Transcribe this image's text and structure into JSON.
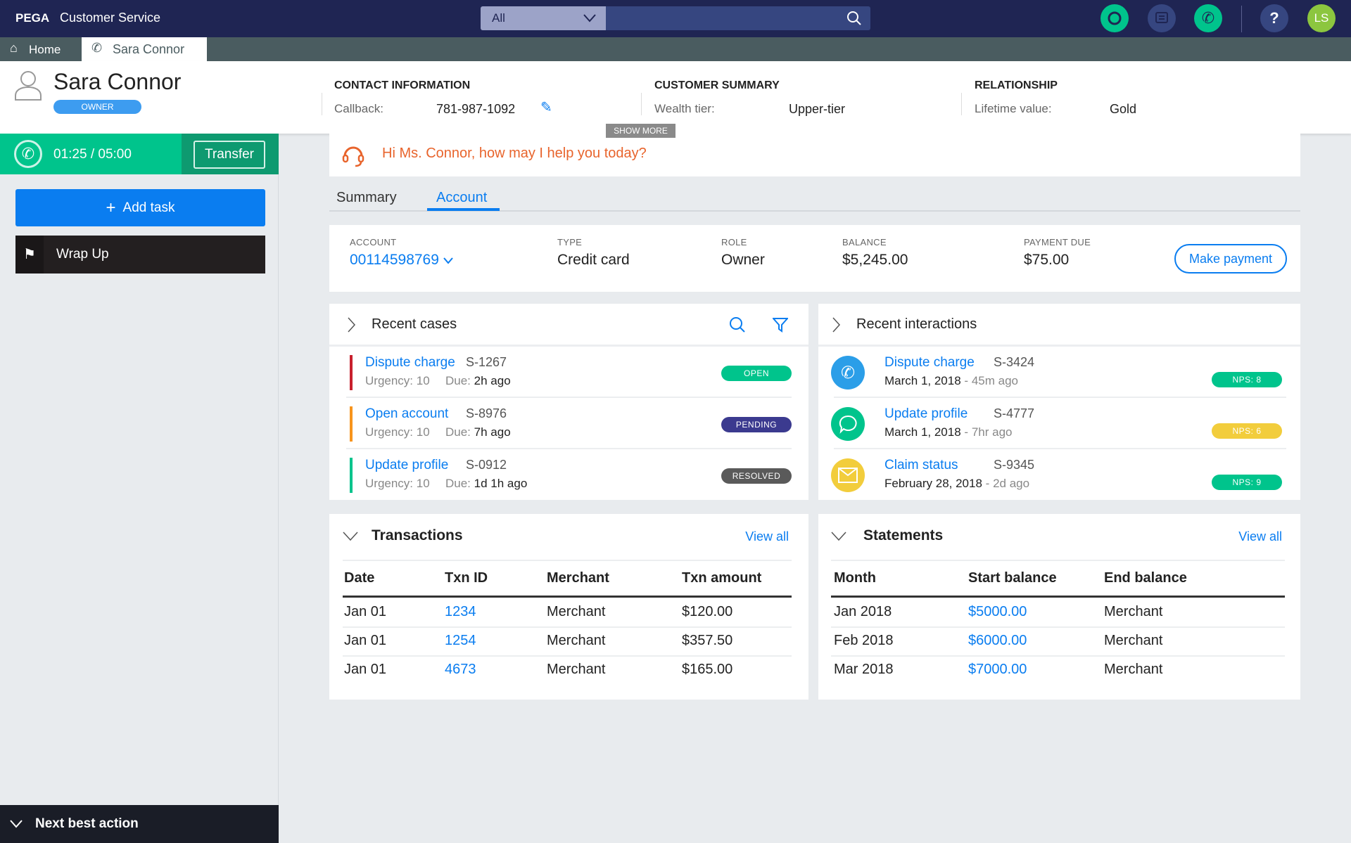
{
  "app": {
    "logo": "PEGA",
    "title": "Customer Service"
  },
  "search": {
    "scope": "All",
    "placeholder": ""
  },
  "topbar": {
    "user_initials": "LS",
    "help": "?"
  },
  "tabs": [
    {
      "label": "Home"
    },
    {
      "label": "Sara Connor"
    }
  ],
  "customer": {
    "name": "Sara Connor",
    "role": "OWNER"
  },
  "contact": {
    "title": "CONTACT INFORMATION",
    "label": "Callback:",
    "value": "781-987-1092"
  },
  "summary": {
    "title": "CUSTOMER SUMMARY",
    "label": "Wealth tier:",
    "value": "Upper-tier"
  },
  "relationship": {
    "title": "RELATIONSHIP",
    "label": "Lifetime value:",
    "value": "Gold"
  },
  "show_more": "SHOW MORE",
  "call": {
    "timer": "01:25 / 05:00",
    "transfer": "Transfer"
  },
  "sidebar": {
    "add_task": "Add task",
    "wrap_up": "Wrap Up",
    "next_best_action": "Next best action"
  },
  "greeting": "Hi Ms. Connor, how may I help you today?",
  "main_tabs": [
    {
      "label": "Summary"
    },
    {
      "label": "Account"
    }
  ],
  "account": {
    "account_label": "ACCOUNT",
    "account_value": "00114598769",
    "type_label": "TYPE",
    "type_value": "Credit card",
    "role_label": "ROLE",
    "role_value": "Owner",
    "balance_label": "BALANCE",
    "balance_value": "$5,245.00",
    "due_label": "PAYMENT DUE",
    "due_value": "$75.00",
    "make_payment": "Make payment"
  },
  "recent_cases": {
    "title": "Recent cases",
    "items": [
      {
        "title": "Dispute charge",
        "id": "S-1267",
        "urgency_label": "Urgency:",
        "urgency": "10",
        "due_label": "Due:",
        "due": "2h ago",
        "status": "OPEN",
        "color": "#c8202d",
        "status_color": "#00c48c"
      },
      {
        "title": "Open account",
        "id": "S-8976",
        "urgency_label": "Urgency:",
        "urgency": "10",
        "due_label": "Due:",
        "due": "7h ago",
        "status": "PENDING",
        "color": "#f7941d",
        "status_color": "#3b3a8f"
      },
      {
        "title": "Update profile",
        "id": "S-0912",
        "urgency_label": "Urgency:",
        "urgency": "10",
        "due_label": "Due:",
        "due": "1d 1h ago",
        "status": "RESOLVED",
        "color": "#00c48c",
        "status_color": "#5a5a5a"
      }
    ]
  },
  "recent_interactions": {
    "title": "Recent interactions",
    "items": [
      {
        "title": "Dispute charge",
        "id": "S-3424",
        "date": "March 1, 2018",
        "ago": "45m ago",
        "nps": "NPS: 8",
        "icon": "phone-icon",
        "icon_color": "#2b9ee8",
        "nps_color": "#00c48c"
      },
      {
        "title": "Update profile",
        "id": "S-4777",
        "date": "March 1, 2018",
        "ago": "7hr ago",
        "nps": "NPS: 6",
        "icon": "chat-icon",
        "icon_color": "#00c48c",
        "nps_color": "#f2cd3c"
      },
      {
        "title": "Claim status",
        "id": "S-9345",
        "date": "February 28, 2018",
        "ago": "2d ago",
        "nps": "NPS: 9",
        "icon": "email-icon",
        "icon_color": "#f2cd3c",
        "nps_color": "#00c48c"
      }
    ]
  },
  "transactions": {
    "title": "Transactions",
    "view_all": "View all",
    "columns": [
      "Date",
      "Txn ID",
      "Merchant",
      "Txn amount"
    ],
    "rows": [
      [
        "Jan 01",
        "1234",
        "Merchant",
        "$120.00"
      ],
      [
        "Jan 01",
        "1254",
        "Merchant",
        "$357.50"
      ],
      [
        "Jan 01",
        "4673",
        "Merchant",
        "$165.00"
      ]
    ]
  },
  "statements": {
    "title": "Statements",
    "view_all": "View all",
    "columns": [
      "Month",
      "Start balance",
      "End balance"
    ],
    "rows": [
      [
        "Jan 2018",
        "$5000.00",
        "Merchant"
      ],
      [
        "Feb 2018",
        "$6000.00",
        "Merchant"
      ],
      [
        "Mar 2018",
        "$7000.00",
        "Merchant"
      ]
    ]
  }
}
